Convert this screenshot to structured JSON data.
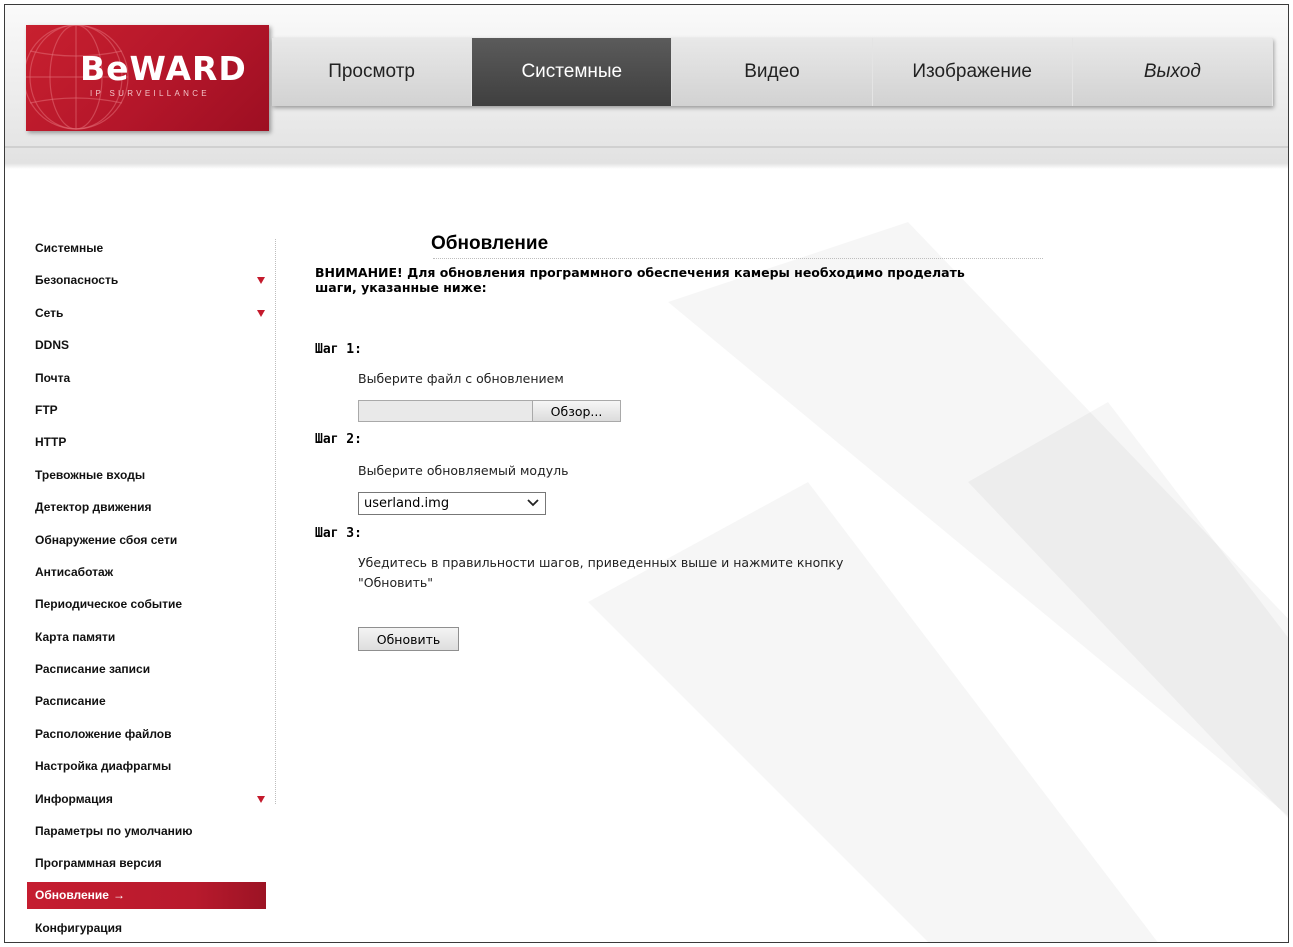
{
  "brand": {
    "name": "BeWARD",
    "tagline": "IP SURVEILLANCE"
  },
  "nav": {
    "items": [
      {
        "label": "Просмотр",
        "active": false
      },
      {
        "label": "Системные",
        "active": true
      },
      {
        "label": "Видео",
        "active": false
      },
      {
        "label": "Изображение",
        "active": false
      },
      {
        "label": "Выход",
        "active": false
      }
    ]
  },
  "sidebar": {
    "items": [
      {
        "label": "Системные",
        "expandable": false
      },
      {
        "label": "Безопасность",
        "expandable": true
      },
      {
        "label": "Сеть",
        "expandable": true
      },
      {
        "label": "DDNS",
        "expandable": false
      },
      {
        "label": "Почта",
        "expandable": false
      },
      {
        "label": "FTP",
        "expandable": false
      },
      {
        "label": "HTTP",
        "expandable": false
      },
      {
        "label": "Тревожные входы",
        "expandable": false
      },
      {
        "label": "Детектор движения",
        "expandable": false
      },
      {
        "label": "Обнаружение сбоя сети",
        "expandable": false
      },
      {
        "label": "Антисаботаж",
        "expandable": false
      },
      {
        "label": "Периодическое событие",
        "expandable": false
      },
      {
        "label": "Карта памяти",
        "expandable": false
      },
      {
        "label": "Расписание записи",
        "expandable": false
      },
      {
        "label": "Расписание",
        "expandable": false
      },
      {
        "label": "Расположение файлов",
        "expandable": false
      },
      {
        "label": "Настройка диафрагмы",
        "expandable": false
      },
      {
        "label": "Информация",
        "expandable": true
      },
      {
        "label": "Параметры по умолчанию",
        "expandable": false
      },
      {
        "label": "Программная версия",
        "expandable": false
      },
      {
        "label": "Обновление",
        "expandable": false,
        "active": true,
        "arrow": "→"
      },
      {
        "label": "Конфигурация",
        "expandable": false
      }
    ]
  },
  "main": {
    "title": "Обновление",
    "warning": "ВНИМАНИЕ! Для обновления программного обеспечения камеры необходимо проделать шаги, указанные ниже:",
    "step1": {
      "label": "Шаг 1:",
      "description": "Выберите файл с обновлением",
      "file_value": "",
      "browse_label": "Обзор..."
    },
    "step2": {
      "label": "Шаг 2:",
      "description": "Выберите обновляемый модуль",
      "selected_module": "userland.img"
    },
    "step3": {
      "label": "Шаг 3:",
      "description_line1": "Убедитесь в правильности шагов, приведенных выше и нажмите кнопку",
      "description_line2": "\"Обновить\""
    },
    "update_button": "Обновить"
  },
  "colors": {
    "brand_red": "#c41a2c",
    "nav_active": "#4a4a4a",
    "header_bg": "#e6e6e6"
  }
}
